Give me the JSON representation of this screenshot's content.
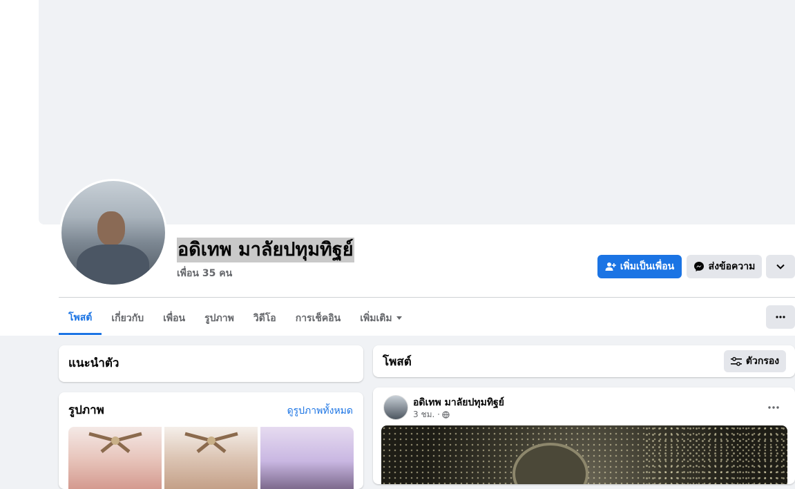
{
  "profile": {
    "name": "อดิเทพ มาลัยปทุมทิฐย์",
    "friends_count": "เพื่อน 35 คน"
  },
  "actions": {
    "add_friend_label": "เพิ่มเป็นเพื่อน",
    "message_label": "ส่งข้อความ"
  },
  "tabs": [
    {
      "label": "โพสต์",
      "active": true
    },
    {
      "label": "เกี่ยวกับ"
    },
    {
      "label": "เพื่อน"
    },
    {
      "label": "รูปภาพ"
    },
    {
      "label": "วิดีโอ"
    },
    {
      "label": "การเช็คอิน"
    },
    {
      "label": "เพิ่มเติม"
    }
  ],
  "intro": {
    "title": "แนะนำตัว"
  },
  "photos": {
    "title": "รูปภาพ",
    "see_all_label": "ดูรูปภาพทั้งหมด"
  },
  "posts_section": {
    "title": "โพสต์",
    "filter_label": "ตัวกรอง"
  },
  "post": {
    "author": "อดิเทพ มาลัยปทุมทิฐย์",
    "time": "3 ชม. ·"
  },
  "colors": {
    "accent": "#1b74e4",
    "button_gray": "#e4e6eb",
    "page_bg": "#f0f2f5"
  }
}
